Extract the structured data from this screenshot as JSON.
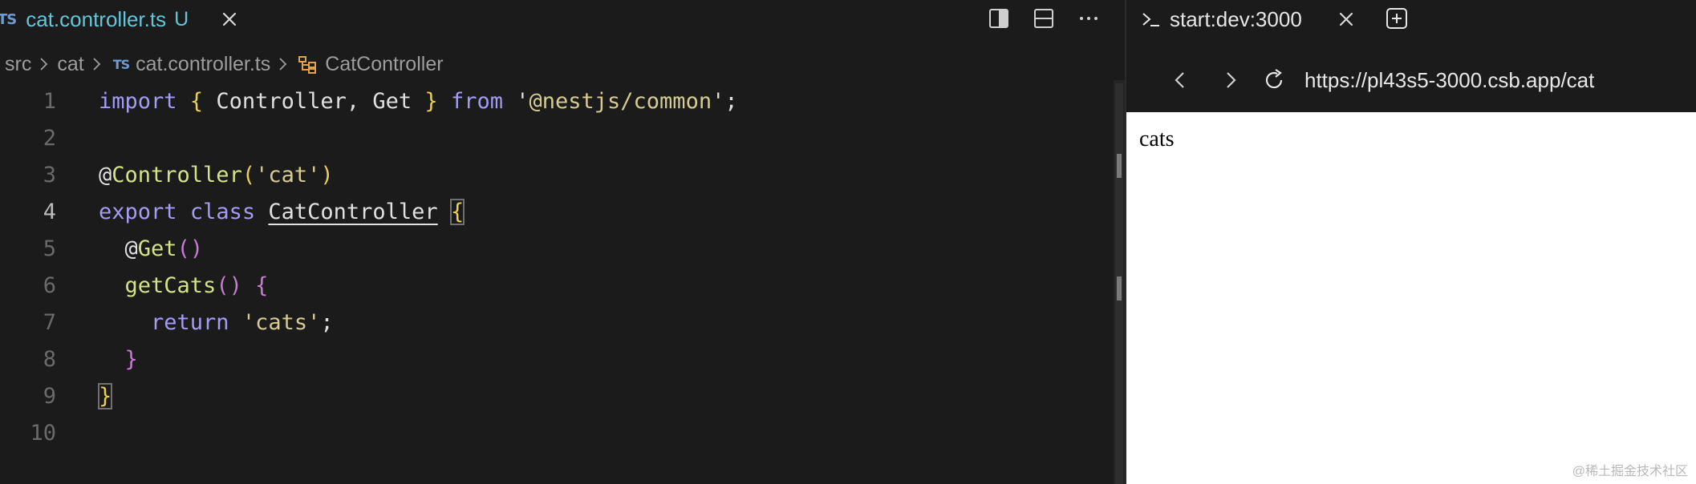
{
  "editor": {
    "tab": {
      "badge": "TS",
      "filename": "cat.controller.ts",
      "status": "U"
    },
    "breadcrumb": {
      "items": [
        "src",
        "cat"
      ],
      "file_badge": "TS",
      "file": "cat.controller.ts",
      "symbol": "CatController"
    },
    "lines": [
      {
        "n": "1",
        "parts": [
          {
            "t": "import",
            "c": "kw"
          },
          {
            "t": " "
          },
          {
            "t": "{",
            "c": "br1"
          },
          {
            "t": " Controller, Get ",
            "c": "plain"
          },
          {
            "t": "}",
            "c": "br1"
          },
          {
            "t": " "
          },
          {
            "t": "from",
            "c": "kw"
          },
          {
            "t": " '",
            "c": "plain"
          },
          {
            "t": "@nestjs/common",
            "c": "str"
          },
          {
            "t": "';",
            "c": "plain"
          }
        ]
      },
      {
        "n": "2",
        "parts": []
      },
      {
        "n": "3",
        "parts": [
          {
            "t": "@",
            "c": "plain"
          },
          {
            "t": "Controller",
            "c": "fn"
          },
          {
            "t": "(",
            "c": "br1"
          },
          {
            "t": "'cat'",
            "c": "str"
          },
          {
            "t": ")",
            "c": "br1"
          }
        ]
      },
      {
        "n": "4",
        "parts": [
          {
            "t": "export",
            "c": "kw"
          },
          {
            "t": " "
          },
          {
            "t": "class",
            "c": "kw"
          },
          {
            "t": " "
          },
          {
            "t": "CatController",
            "c": "plain ul"
          },
          {
            "t": " "
          },
          {
            "t": "{",
            "c": "br1 boxed"
          }
        ]
      },
      {
        "n": "5",
        "parts": [
          {
            "t": "  @",
            "c": "plain"
          },
          {
            "t": "Get",
            "c": "fn"
          },
          {
            "t": "()",
            "c": "br2"
          }
        ]
      },
      {
        "n": "6",
        "parts": [
          {
            "t": "  "
          },
          {
            "t": "getCats",
            "c": "fn"
          },
          {
            "t": "()",
            "c": "br2"
          },
          {
            "t": " "
          },
          {
            "t": "{",
            "c": "br2"
          }
        ]
      },
      {
        "n": "7",
        "parts": [
          {
            "t": "    "
          },
          {
            "t": "return",
            "c": "kw"
          },
          {
            "t": " "
          },
          {
            "t": "'cats'",
            "c": "str"
          },
          {
            "t": ";",
            "c": "plain"
          }
        ]
      },
      {
        "n": "8",
        "parts": [
          {
            "t": "  "
          },
          {
            "t": "}",
            "c": "br2"
          }
        ]
      },
      {
        "n": "9",
        "parts": [
          {
            "t": "}",
            "c": "br1 boxed"
          }
        ]
      },
      {
        "n": "10",
        "parts": []
      }
    ]
  },
  "panel": {
    "tab": {
      "title": "start:dev:3000"
    },
    "browser": {
      "url": "https://pl43s5-3000.csb.app/cat",
      "content": "cats"
    }
  },
  "watermark": "@稀土掘金技术社区",
  "icons": {
    "tab_close": "close-icon",
    "split_right": "split-editor-right-icon",
    "split_down": "split-editor-down-icon",
    "more": "more-actions-icon",
    "terminal": "terminal-prompt-icon",
    "new_tab": "new-tab-icon",
    "back": "back-arrow-icon",
    "forward": "forward-arrow-icon",
    "reload": "reload-icon",
    "symbol_class": "symbol-class-icon",
    "separator": "chevron-right-icon"
  },
  "colors": {
    "keyword": "#a49bf3",
    "function": "#d6e288",
    "string": "#d6cc92",
    "bracket1": "#e8d155",
    "bracket2": "#c77bd3",
    "tab_text": "#63c6d8",
    "ts_badge": "#6f9bd1"
  }
}
